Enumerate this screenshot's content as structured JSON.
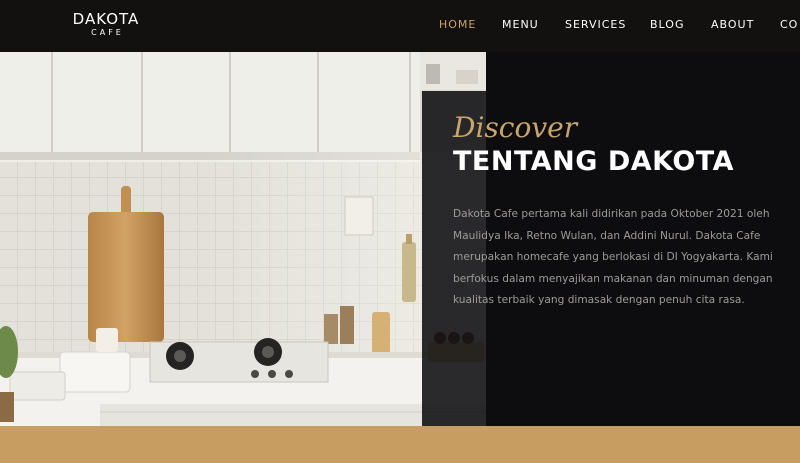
{
  "brand": {
    "name": "DAKOTA",
    "tagline": "CAFE"
  },
  "nav": {
    "items": [
      {
        "label": "HOME",
        "active": true
      },
      {
        "label": "MENU",
        "active": false
      },
      {
        "label": "SERVICES",
        "active": false
      },
      {
        "label": "BLOG",
        "active": false
      },
      {
        "label": "ABOUT",
        "active": false
      },
      {
        "label": "CO",
        "active": false
      }
    ]
  },
  "about": {
    "script_label": "Discover",
    "title": "TENTANG DAKOTA",
    "description": "Dakota Cafe pertama kali didirikan pada Oktober 2021 oleh Maulidya Ika, Retno Wulan, dan Addini Nurul. Dakota Cafe merupakan homecafe yang berlokasi di DI Yogyakarta. Kami berfokus dalam menyajikan makanan dan minuman dengan kualitas terbaik yang dimasak dengan penuh cita rasa."
  },
  "colors": {
    "navbar_bg": "#131110",
    "accent": "#c9a46c",
    "band": "#c89d61",
    "panel": "#0d0d0f"
  }
}
